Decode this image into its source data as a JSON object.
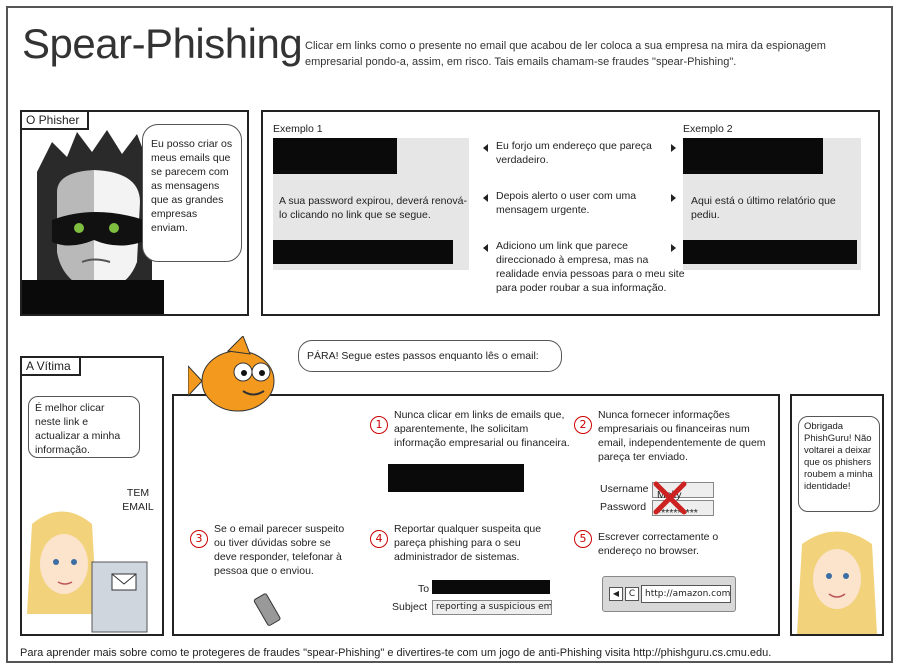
{
  "title": "Spear-Phishing",
  "intro": "Clicar em links como o presente no email que acabou de ler coloca a sua empresa na mira da espionagem empresarial pondo-a, assim, em risco. Tais emails chamam-se fraudes \"spear-Phishing\".",
  "phisher": {
    "tag": "O Phisher",
    "speech": "Eu posso criar os meus emails que se parecem com as mensagens que as grandes empresas enviam."
  },
  "examples": {
    "example1_label": "Exemplo 1",
    "example1_text": "A sua password expirou, deverá renová-lo clicando no link que se segue.",
    "example2_label": "Exemplo 2",
    "example2_text": "Aqui está o último relatório que pediu.",
    "steps": [
      "Eu forjo um endereço que pareça verdadeiro.",
      "Depois alerto o user com uma mensagem urgente.",
      "Adiciono um link que parece direccionado à empresa, mas na realidade envia pessoas para o meu site para poder roubar a sua informação."
    ]
  },
  "victim": {
    "tag": "A Vítima",
    "speech": "É melhor clicar neste link e actualizar a minha informação.",
    "sound": "TEM EMAIL"
  },
  "fish": {
    "speech": "PÁRA! Segue estes passos enquanto lês o email:"
  },
  "tips": [
    {
      "n": "1",
      "text": "Nunca clicar em links de emails que, aparentemente, lhe solicitam informação empresarial ou financeira."
    },
    {
      "n": "2",
      "text": "Nunca fornecer informações empresariais ou financeiras num email, independentemente de quem pareça ter enviado."
    },
    {
      "n": "3",
      "text": "Se o email parecer suspeito ou tiver dúvidas sobre se deve responder, telefonar à pessoa que o enviou."
    },
    {
      "n": "4",
      "text": "Reportar qualquer suspeita que pareça phishing para o seu administrador de sistemas."
    },
    {
      "n": "5",
      "text": "Escrever correctamente o endereço no browser."
    }
  ],
  "login": {
    "username_label": "Username",
    "username_value": "Molly",
    "password_label": "Password",
    "password_value": "**********"
  },
  "report": {
    "to_label": "To",
    "subject_label": "Subject",
    "subject_value": "reporting a suspicious email"
  },
  "browser": {
    "url": "http://amazon.com"
  },
  "thanks": {
    "speech": "Obrigada PhishGuru! Não voltarei a deixar que os phishers roubem a minha identidade!"
  },
  "footer": "Para aprender mais sobre como te protegeres de fraudes \"spear-Phishing\" e divertires-te com um jogo de anti-Phishing visita http://phishguru.cs.cmu.edu.",
  "colors": {
    "accent_red": "#cc0000",
    "fish_orange": "#f39a1e",
    "panel_gray": "#e6e6e6"
  }
}
